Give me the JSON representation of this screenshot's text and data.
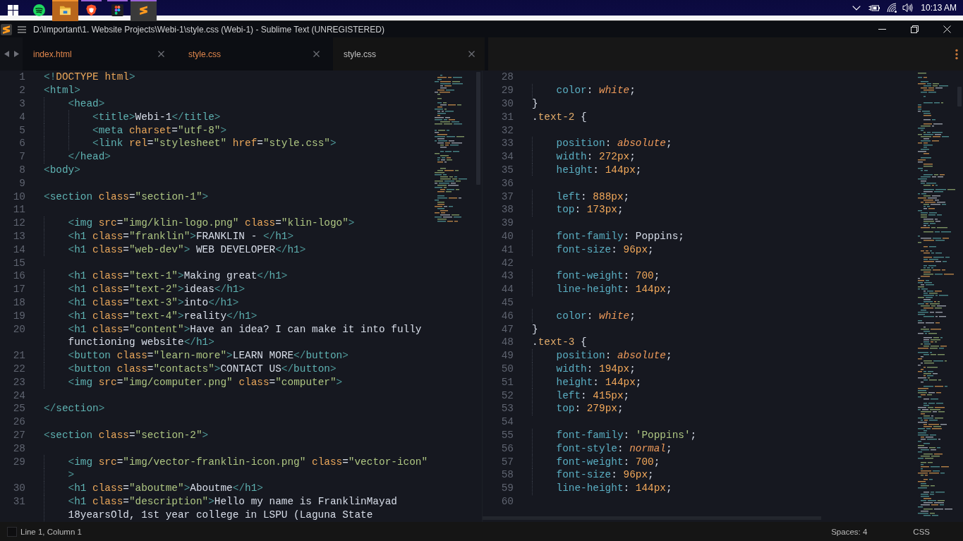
{
  "taskbar": {
    "apps": [
      {
        "kind": "player",
        "running": false,
        "flashing": false,
        "selected": false
      },
      {
        "kind": "files",
        "running": true,
        "flashing": true,
        "selected": false
      },
      {
        "kind": "browser",
        "running": true,
        "flashing": false,
        "selected": false
      },
      {
        "kind": "design",
        "running": true,
        "flashing": false,
        "selected": false
      },
      {
        "kind": "editor",
        "running": true,
        "flashing": false,
        "selected": true
      }
    ],
    "clock": "10:13 AM"
  },
  "window": {
    "title": "D:\\Important\\1. Website Projects\\Webi-1\\style.css (Webi-1) - Sublime Text (UNREGISTERED)"
  },
  "tabs": [
    {
      "label": "index.html",
      "selected": false
    },
    {
      "label": "style.css",
      "selected": false
    },
    {
      "label": "style.css",
      "selected": true
    }
  ],
  "panes": [
    {
      "kind": "html",
      "lines": [
        {
          "number": "1",
          "text": "<!DOCTYPE html>"
        },
        {
          "number": "2",
          "text": "<html>"
        },
        {
          "number": "3",
          "text": "    <head>"
        },
        {
          "number": "4",
          "text": "        <title>Webi-1</title>"
        },
        {
          "number": "5",
          "text": "        <meta charset=\"utf-8\">"
        },
        {
          "number": "6",
          "text": "        <link rel=\"stylesheet\" href=\"style.css\">"
        },
        {
          "number": "7",
          "text": "    </head>"
        },
        {
          "number": "8",
          "text": "<body>"
        },
        {
          "number": "9"
        },
        {
          "number": "10",
          "text": "<section class=\"section-1\">"
        },
        {
          "number": "11"
        },
        {
          "number": "12",
          "text": "    <img src=\"img/klin-logo.png\" class=\"klin-logo\">"
        },
        {
          "number": "13",
          "text": "    <h1 class=\"franklin\">FRANKLIN - </h1>"
        },
        {
          "number": "14",
          "text": "    <h1 class=\"web-dev\"> WEB DEVELOPER</h1>"
        },
        {
          "number": "15"
        },
        {
          "number": "16",
          "text": "    <h1 class=\"text-1\">Making great</h1>"
        },
        {
          "number": "17",
          "text": "    <h1 class=\"text-2\">ideas</h1>"
        },
        {
          "number": "18",
          "text": "    <h1 class=\"text-3\">into</h1>"
        },
        {
          "number": "19",
          "text": "    <h1 class=\"text-4\">reality</h1>"
        },
        {
          "number": "20",
          "text": "    <h1 class=\"content\">Have an idea? I can make it into fully",
          "wrapped": [
            "functioning website</h1>"
          ]
        },
        {
          "number": "21",
          "text": "    <button class=\"learn-more\">LEARN MORE</button>"
        },
        {
          "number": "22",
          "text": "    <button class=\"contacts\">CONTACT US</button>"
        },
        {
          "number": "23",
          "text": "    <img src=\"img/computer.png\" class=\"computer\">"
        },
        {
          "number": "24"
        },
        {
          "number": "25",
          "text": "</section>"
        },
        {
          "number": "26"
        },
        {
          "number": "27",
          "text": "<section class=\"section-2\">"
        },
        {
          "number": "28"
        },
        {
          "number": "29",
          "text": "    <img src=\"img/vector-franklin-icon.png\" class=\"vector-icon\"",
          "wrapped": [
            ">"
          ]
        },
        {
          "number": "30",
          "text": "    <h1 class=\"aboutme\">Aboutme</h1>"
        },
        {
          "number": "31",
          "text": "    <h1 class=\"description\">Hello my name is FranklinMayad",
          "wrapped": [
            "18yearsOld, 1st year college in LSPU (Laguna State"
          ]
        }
      ]
    },
    {
      "kind": "css",
      "lines": [
        {
          "number": "28"
        },
        {
          "number": "29",
          "text": "    color: white;"
        },
        {
          "number": "30",
          "text": "}"
        },
        {
          "number": "31",
          "text": ".text-2 {"
        },
        {
          "number": "32"
        },
        {
          "number": "33",
          "text": "    position: absolute;"
        },
        {
          "number": "34",
          "text": "    width: 272px;"
        },
        {
          "number": "35",
          "text": "    height: 144px;"
        },
        {
          "number": "36"
        },
        {
          "number": "37",
          "text": "    left: 888px;"
        },
        {
          "number": "38",
          "text": "    top: 173px;"
        },
        {
          "number": "39"
        },
        {
          "number": "40",
          "text": "    font-family: Poppins;"
        },
        {
          "number": "41",
          "text": "    font-size: 96px;"
        },
        {
          "number": "42"
        },
        {
          "number": "43",
          "text": "    font-weight: 700;"
        },
        {
          "number": "44",
          "text": "    line-height: 144px;"
        },
        {
          "number": "45"
        },
        {
          "number": "46",
          "text": "    color: white;"
        },
        {
          "number": "47",
          "text": "}"
        },
        {
          "number": "48",
          "text": ".text-3 {"
        },
        {
          "number": "49",
          "text": "    position: absolute;"
        },
        {
          "number": "50",
          "text": "    width: 194px;"
        },
        {
          "number": "51",
          "text": "    height: 144px;"
        },
        {
          "number": "52",
          "text": "    left: 415px;"
        },
        {
          "number": "53",
          "text": "    top: 279px;"
        },
        {
          "number": "54"
        },
        {
          "number": "55",
          "text": "    font-family: 'Poppins';"
        },
        {
          "number": "56",
          "text": "    font-style: normal;"
        },
        {
          "number": "57",
          "text": "    font-weight: 700;"
        },
        {
          "number": "58",
          "text": "    font-size: 96px;"
        },
        {
          "number": "59",
          "text": "    line-height: 144px;"
        },
        {
          "number": "60"
        }
      ]
    }
  ],
  "status_bar": {
    "position": "Line 1, Column 1",
    "indentation": "Spaces: 4",
    "syntax": "CSS"
  }
}
